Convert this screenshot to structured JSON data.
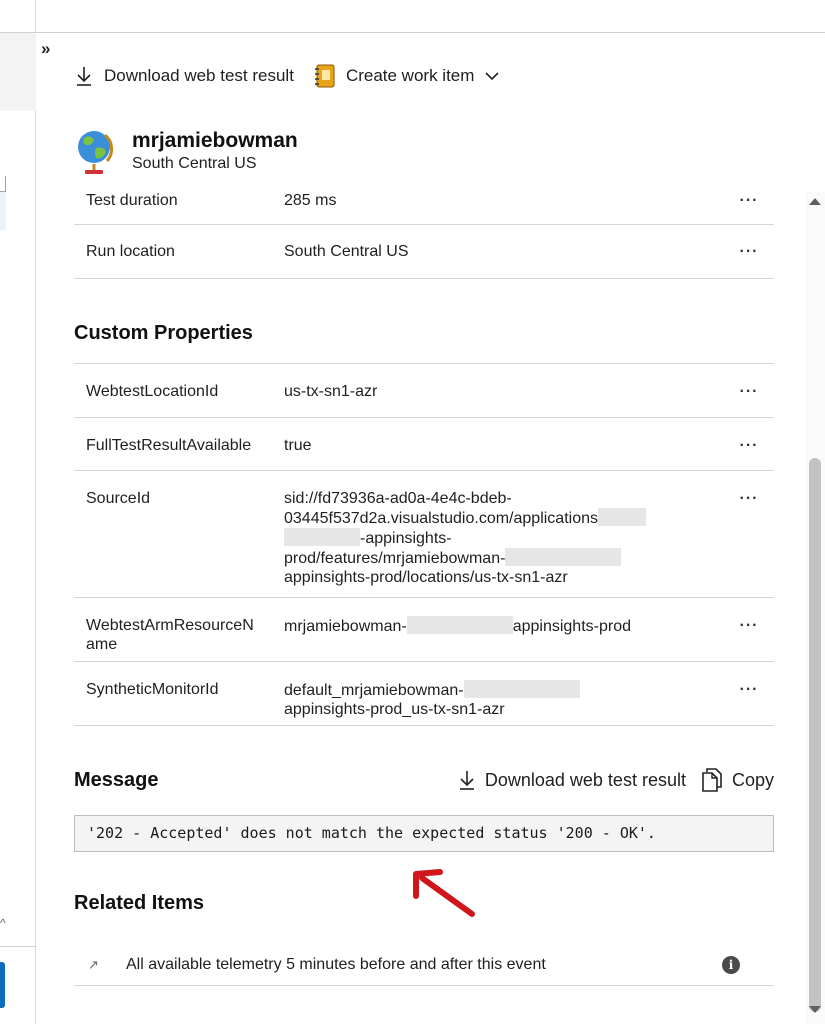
{
  "expand": {
    "glyph": "»"
  },
  "toolbar": {
    "download_label": "Download web test result",
    "create_work_item_label": "Create work item"
  },
  "resource": {
    "name": "mrjamiebowman",
    "location": "South Central US"
  },
  "summary_rows": [
    {
      "key": "Test duration",
      "value": "285 ms"
    },
    {
      "key": "Run location",
      "value": "South Central US"
    }
  ],
  "more_glyph": "···",
  "custom_properties": {
    "title": "Custom Properties",
    "rows": [
      {
        "key": "WebtestLocationId",
        "value": "us-tx-sn1-azr"
      },
      {
        "key": "FullTestResultAvailable",
        "value": "true"
      },
      {
        "key": "SourceId",
        "value_line1": "sid://fd73936a-ad0a-4e4c-bdeb-",
        "value_line2": "03445f537d2a.visualstudio.com/applications",
        "value_line3": "-appinsights-",
        "value_line4": "prod/features/mrjamiebowman-",
        "value_line5": "appinsights-prod/locations/us-tx-sn1-azr"
      },
      {
        "key_line1": "WebtestArmResourceN",
        "key_line2": "ame",
        "value_part1": "mrjamiebowman-",
        "value_part2": "appinsights-prod"
      },
      {
        "key": "SyntheticMonitorId",
        "value_line1": "default_mrjamiebowman-",
        "value_line2": "appinsights-prod_us-tx-sn1-azr"
      }
    ]
  },
  "message": {
    "title": "Message",
    "download_label": "Download web test result",
    "copy_label": "Copy",
    "text": "'202 - Accepted' does not match the expected status '200 - OK'."
  },
  "related": {
    "title": "Related Items",
    "item_label": "All available telemetry 5 minutes before and after this event",
    "info_glyph": "i",
    "link_glyph": "↗"
  },
  "colors": {
    "arrow": "#d0161b",
    "accent": "#0f6cbd"
  }
}
